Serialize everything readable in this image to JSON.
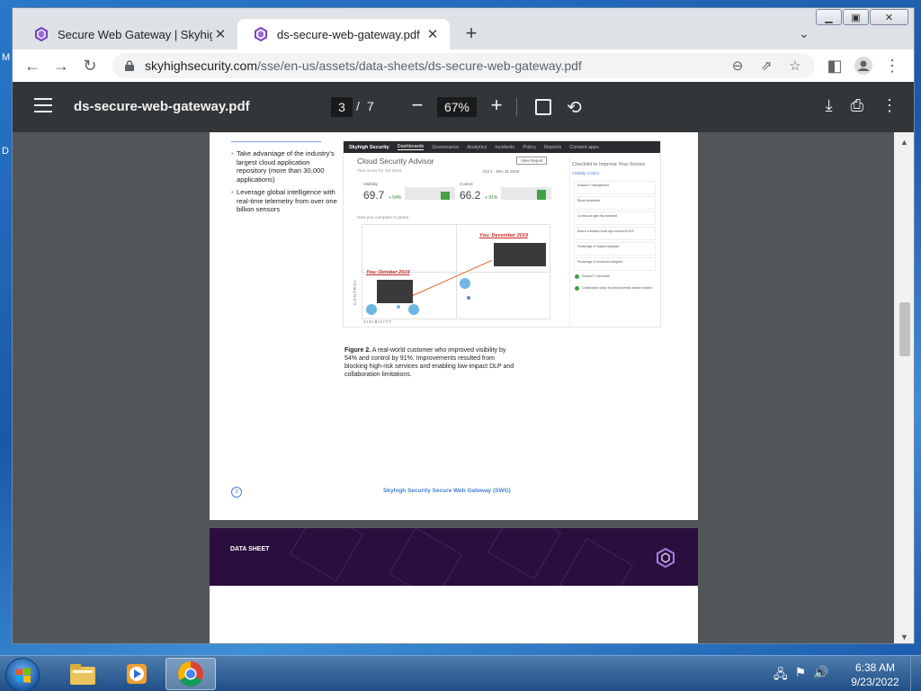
{
  "desktop": {
    "left_glyph_1": "M",
    "left_glyph_2": "D"
  },
  "browser": {
    "tabs": [
      {
        "title": "Secure Web Gateway | Skyhigh S",
        "active": false
      },
      {
        "title": "ds-secure-web-gateway.pdf",
        "active": true
      }
    ],
    "url_host": "skyhighsecurity.com",
    "url_path": "/sse/en-us/assets/data-sheets/ds-secure-web-gateway.pdf"
  },
  "pdf": {
    "filename": "ds-secure-web-gateway.pdf",
    "current_page": "3",
    "page_separator": "/",
    "total_pages": "7",
    "zoom": "67%",
    "scroll_position": 0.36
  },
  "page": {
    "bullets": [
      "Take advantage of the industry's largest cloud application repository (more than 30,000 applications)",
      "Leverage global intelligence with real-time telemetry from over one billion sensors"
    ],
    "screenshot": {
      "nav": [
        "Skyhigh Security",
        "Dashboards",
        "Governance",
        "Analytics",
        "Incidents",
        "Policy",
        "Reports",
        "Content apps"
      ],
      "title": "Cloud Security Advisor",
      "subtitle": "Your score for Q4 2019",
      "view_button": "View Report",
      "date_range": "Oct 1 - Dec 31 2019",
      "visibility_label": "Visibility",
      "visibility_value": "69.7",
      "visibility_delta": "+ 54%",
      "control_label": "Control",
      "control_value": "66.2",
      "control_delta": "+ 91%",
      "compare_label": "How you compare to peers",
      "annotation_dec": "You: December 2019",
      "annotation_oct": "You: October 2019",
      "y_axis": "CONTROL",
      "x_axis": "VISIBILITY",
      "checklist_title": "Checklist to Improve Your Scores",
      "checklist_tabs": "Visibility   Control",
      "checklist_items": [
        "Shadow IT management",
        "Report scheduled",
        "Continuous apps risk assessed",
        "Data in a shadow cloud app covered for DLP",
        "Percentage of Shadow uploaded",
        "Percentage of connectors assigned",
        "Shadow IT connected",
        "Collaboration policy for personal email domain enabled"
      ]
    },
    "caption_bold": "Figure 2.",
    "caption_text": " A real-world customer who improved visibility by 54% and control by 91%. Improvements resulted from blocking high-risk services and enabling low-impact DLP and collaboration limitations.",
    "page_number": "3",
    "footer": "Skyhigh Security Secure Web Gateway (SWG)"
  },
  "next_page": {
    "banner_label": "DATA SHEET"
  },
  "taskbar": {
    "time": "6:38 AM",
    "date": "9/23/2022"
  }
}
